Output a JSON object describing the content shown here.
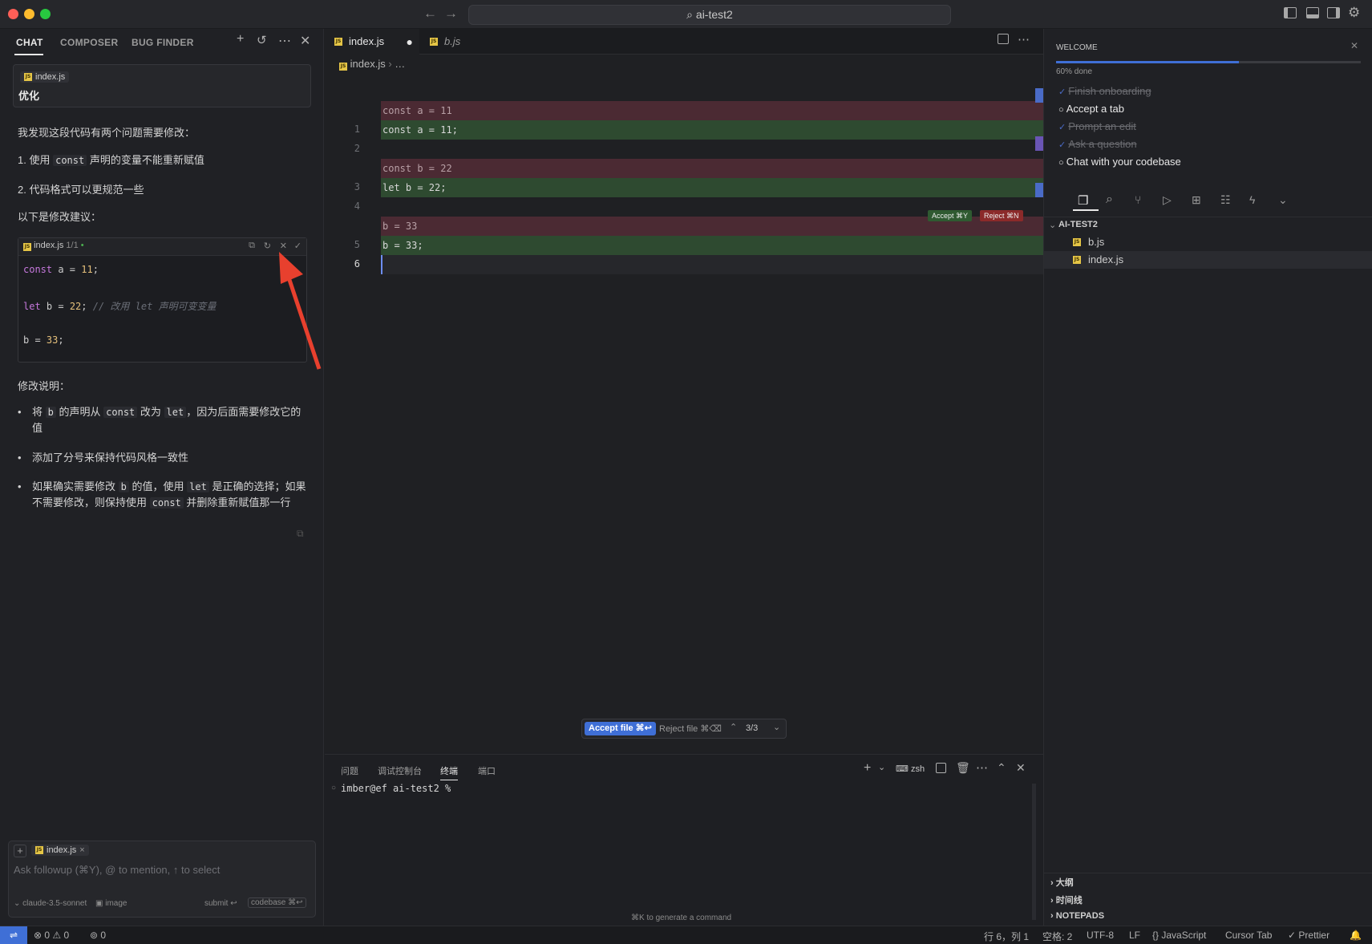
{
  "window": {
    "title": "ai-test2"
  },
  "chat": {
    "tabs": [
      "CHAT",
      "COMPOSER",
      "BUG FINDER"
    ],
    "user_msg": {
      "file": "index.js",
      "text": "优化"
    },
    "response": {
      "intro": "我发现这段代码有两个问题需要修改：",
      "item1_pre": "1. 使用",
      "item1_code": "const",
      "item1_post": "声明的变量不能重新赋值",
      "item2": "2. 代码格式可以更规范一些",
      "suggest": "以下是修改建议：",
      "code_file": "index.js",
      "code_count": "1/1",
      "code_l1": [
        "const",
        " a = ",
        "11",
        ";"
      ],
      "code_l2": [
        "let",
        " b = ",
        "22",
        ";",
        "  // 改用 let 声明可变变量"
      ],
      "code_l3": [
        "b = ",
        "33",
        ";"
      ],
      "explain_title": "修改说明：",
      "b1": [
        "将",
        "b",
        "的声明从",
        "const",
        "改为",
        "let",
        "，因为后面需要修改它的值"
      ],
      "b2": "添加了分号来保持代码风格一致性",
      "b3": [
        "如果确实需要修改",
        "b",
        "的值，使用",
        "let",
        "是正确的选择；如果不需要修改，则保持使用",
        "const",
        "并删除重新赋值那一行"
      ]
    },
    "input": {
      "chip": "index.js",
      "placeholder": "Ask followup (⌘Y), @ to mention, ↑ to select",
      "model": "claude-3.5-sonnet",
      "image": "image",
      "submit": "submit ↩",
      "codebase": "codebase ⌘↩"
    }
  },
  "editor": {
    "tabs": [
      {
        "label": "index.js"
      },
      {
        "label": "b.js"
      }
    ],
    "breadcrumb": {
      "file": "index.js",
      "rest": "…"
    },
    "lines": [
      {
        "kind": "del",
        "num": "",
        "text": "const a = 11"
      },
      {
        "kind": "add",
        "num": "1",
        "text": "const a = 11;"
      },
      {
        "kind": "ctx",
        "num": "2",
        "text": ""
      },
      {
        "kind": "del",
        "num": "",
        "text": "const b = 22"
      },
      {
        "kind": "add",
        "num": "3",
        "text": "let b = 22;"
      },
      {
        "kind": "ctx",
        "num": "4",
        "text": ""
      },
      {
        "kind": "del",
        "num": "",
        "text": "b = 33"
      },
      {
        "kind": "add",
        "num": "5",
        "text": "b = 33;"
      },
      {
        "kind": "cur",
        "num": "6",
        "text": ""
      }
    ],
    "accept_inline": "Accept ⌘Y",
    "reject_inline": "Reject ⌘N",
    "accept_file": "Accept file ⌘↩",
    "reject_file": "Reject file ⌘⌫",
    "nav_count": "3/3"
  },
  "panel": {
    "tabs": [
      "问题",
      "调试控制台",
      "终端",
      "端口"
    ],
    "shell": "zsh",
    "prompt": "imber@ef ai-test2 %",
    "hint": "⌘K to generate a command"
  },
  "right": {
    "welcome_title": "WELCOME",
    "progress_label": "60% done",
    "progress": 0.6,
    "checklist": [
      {
        "label": "Finish onboarding",
        "done": true
      },
      {
        "label": "Accept a tab",
        "done": false
      },
      {
        "label": "Prompt an edit",
        "done": true
      },
      {
        "label": "Ask a question",
        "done": true
      },
      {
        "label": "Chat with your codebase",
        "done": false
      }
    ],
    "explorer_root": "AI-TEST2",
    "files": [
      "b.js",
      "index.js"
    ],
    "sections": [
      "大纲",
      "时间线",
      "NOTEPADS"
    ]
  },
  "status": {
    "errors": "0",
    "warnings": "0",
    "ports": "0",
    "position": "行 6，列 1",
    "spaces": "空格: 2",
    "encoding": "UTF-8",
    "eol": "LF",
    "language": "JavaScript",
    "cursor_tab": "Cursor Tab",
    "prettier": "Prettier"
  },
  "colors": {
    "accent": "#3f6fd6",
    "del_bg": "#4b2a33",
    "add_bg": "#2e4a30",
    "reject": "#8b2a2a"
  }
}
